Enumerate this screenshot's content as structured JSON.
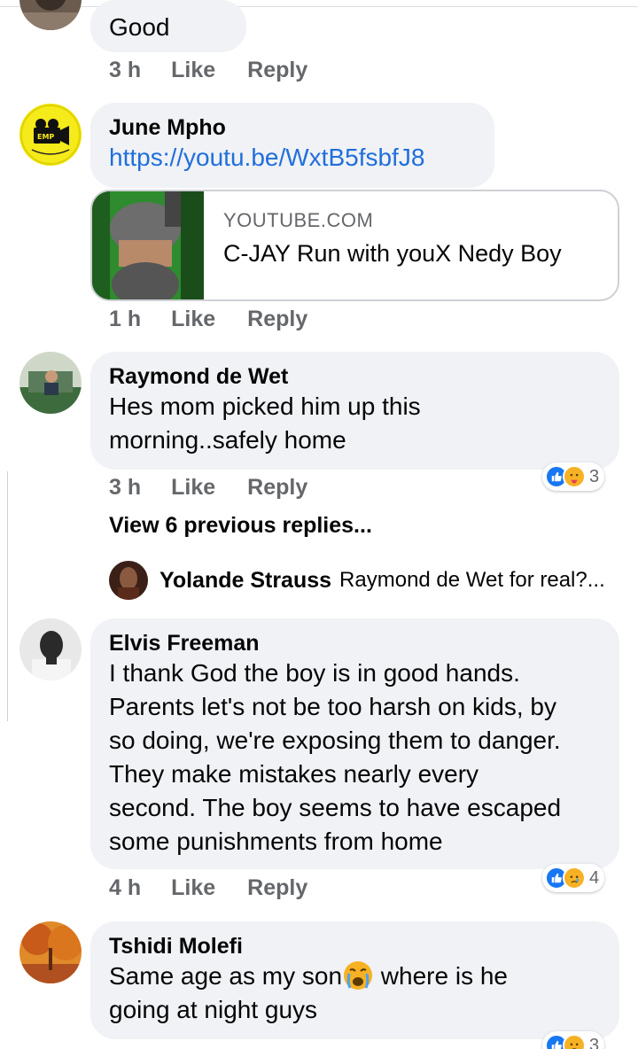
{
  "comments": [
    {
      "text": "Good",
      "time": "3 h",
      "like": "Like",
      "reply": "Reply"
    },
    {
      "author": "June Mpho",
      "text": "https://youtu.be/WxtB5fsbfJ8",
      "time": "1 h",
      "like": "Like",
      "reply": "Reply",
      "link_preview": {
        "domain": "YOUTUBE.COM",
        "title": "C-JAY Run with youX Nedy Boy"
      }
    },
    {
      "author": "Raymond de Wet",
      "text": "Hes mom picked him up this\nmorning..safely home",
      "time": "3 h",
      "like": "Like",
      "reply": "Reply",
      "reactions": {
        "icons": [
          "like-icon",
          "care-icon"
        ],
        "count": "3"
      }
    },
    {
      "author": "Elvis Freeman",
      "text": "I thank God the boy is in good hands.\nParents let's not be too harsh on kids, by\nso doing, we're exposing them to danger.\nThey make mistakes nearly every\nsecond. The boy seems to have escaped\nsome punishments from home",
      "time": "4 h",
      "like": "Like",
      "reply": "Reply",
      "reactions": {
        "icons": [
          "like-icon",
          "sad-icon"
        ],
        "count": "4"
      }
    },
    {
      "author": "Tshidi Molefi",
      "text_before_emoji": "Same age as my son",
      "emoji": "crying-face-icon",
      "text_after_emoji": " where is he\ngoing at night guys",
      "reactions": {
        "icons": [
          "like-icon",
          "sad-icon"
        ],
        "count": "3"
      }
    }
  ],
  "view_previous_replies": "View 6 previous replies...",
  "reply_preview": {
    "author": "Yolande Strauss",
    "text": "Raymond de Wet for real?..."
  },
  "colors": {
    "bubble": "#f0f2f5",
    "link": "#216fdb",
    "meta": "#65676b",
    "like_blue": "#1877f2",
    "emoji_yellow": "#f7b125"
  }
}
